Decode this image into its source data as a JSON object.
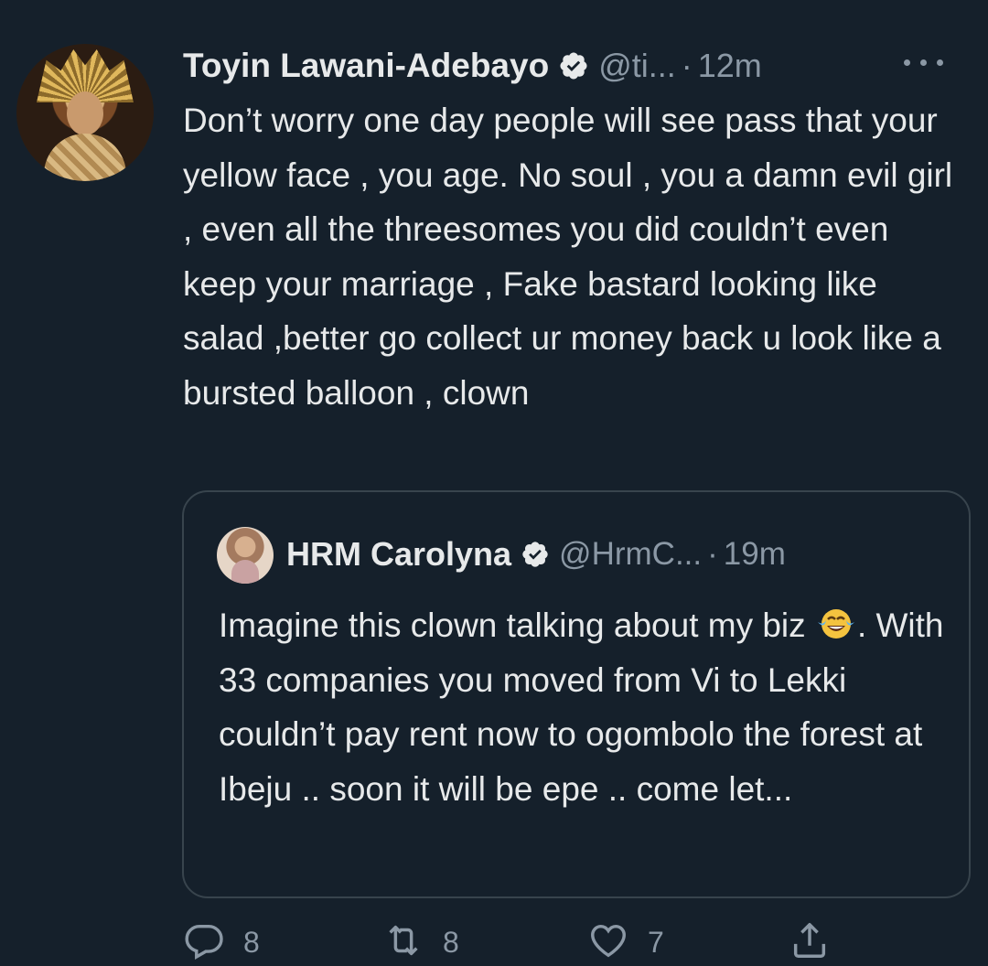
{
  "tweet": {
    "author_name": "Toyin Lawani-Adebayo",
    "handle": "@ti...",
    "separator": "·",
    "time": "12m",
    "text": "Don’t worry one day people will see pass that your yellow face , you age. No soul , you a damn evil girl , even all the threesomes you did couldn’t even keep your marriage , Fake bastard looking like salad ,better go collect ur money back u look like a bursted balloon , clown"
  },
  "quoted_tweet": {
    "author_name": "HRM Carolyna",
    "handle": "@HrmC...",
    "separator": "·",
    "time": "19m",
    "text_before_emoji": "Imagine this clown talking about my biz ",
    "emoji": "face-with-tears-of-joy",
    "text_after_emoji": ". With 33 companies you moved from Vi to Lekki couldn’t pay rent now to ogombolo the forest at Ibeju .. soon it will be epe .. come let..."
  },
  "actions": {
    "replies": "8",
    "retweets": "8",
    "likes": "7"
  },
  "icons": {
    "verified": "verified-badge-icon",
    "more": "more-options-icon",
    "reply": "reply-icon",
    "retweet": "retweet-icon",
    "like": "heart-icon",
    "share": "share-icon"
  },
  "colors": {
    "background": "#15202b",
    "text": "#e7e9ea",
    "secondary_text": "#8b98a5",
    "border": "#38444d"
  }
}
